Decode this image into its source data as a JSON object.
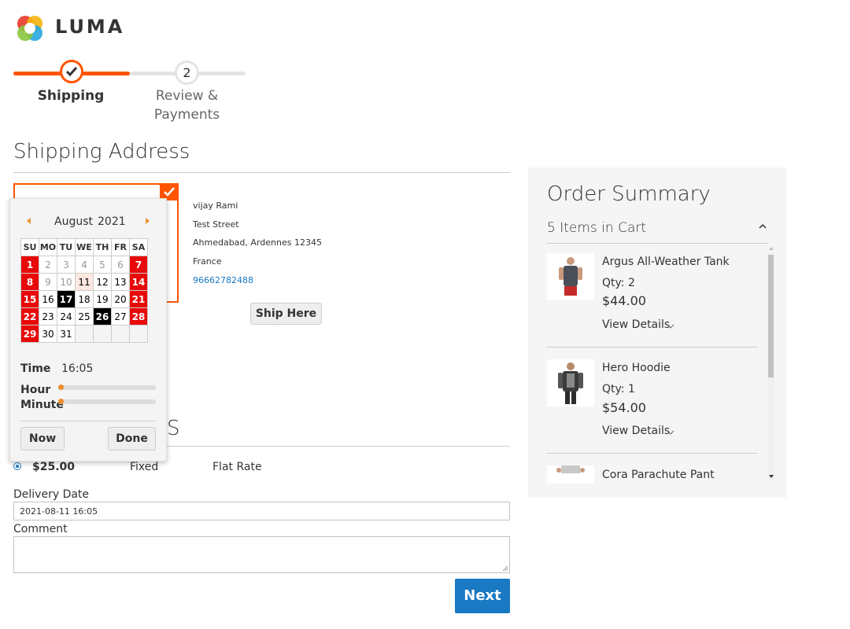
{
  "brand": {
    "name": "LUMA"
  },
  "progress": {
    "steps": [
      {
        "label": "Shipping"
      },
      {
        "number": "2",
        "label_line1": "Review &",
        "label_line2": "Payments"
      }
    ]
  },
  "shipping_address": {
    "title": "Shipping Address",
    "address": {
      "name": "vijay Rami",
      "street": "Test Street",
      "city_line": "Ahmedabad, Ardennes 12345",
      "country": "France",
      "phone": "96662782488"
    },
    "ship_here_label": "Ship Here"
  },
  "calendar": {
    "month": "August",
    "year": "2021",
    "weekdays": [
      "SU",
      "MO",
      "TU",
      "WE",
      "TH",
      "FR",
      "SA"
    ],
    "weeks": [
      [
        "1",
        "2",
        "3",
        "4",
        "5",
        "6",
        "7"
      ],
      [
        "8",
        "9",
        "10",
        "11",
        "12",
        "13",
        "14"
      ],
      [
        "15",
        "16",
        "17",
        "18",
        "19",
        "20",
        "21"
      ],
      [
        "22",
        "23",
        "24",
        "25",
        "26",
        "27",
        "28"
      ],
      [
        "29",
        "30",
        "31",
        "",
        "",
        "",
        ""
      ]
    ],
    "time_label": "Time",
    "time_value": "16:05",
    "hour_label": "Hour",
    "minute_label": "Minute",
    "now_label": "Now",
    "done_label": "Done",
    "title_tail": "S"
  },
  "shipping_method": {
    "price": "$25.00",
    "method": "Fixed",
    "carrier": "Flat Rate"
  },
  "delivery": {
    "date_label": "Delivery Date",
    "date_value": "2021-08-11 16:05",
    "comment_label": "Comment",
    "comment_value": ""
  },
  "next_label": "Next",
  "order_summary": {
    "title": "Order Summary",
    "items_count": "5 Items in Cart",
    "items": [
      {
        "name": "Argus All-Weather Tank",
        "qty": "Qty: 2",
        "price": "$44.00",
        "view": "View Details"
      },
      {
        "name": "Hero Hoodie",
        "qty": "Qty: 1",
        "price": "$54.00",
        "view": "View Details"
      },
      {
        "name": "Cora Parachute Pant"
      }
    ]
  },
  "colors": {
    "accent": "#ff5501",
    "primary_button": "#1979c3",
    "weekend": "#e8090a",
    "link": "#1979c3"
  }
}
